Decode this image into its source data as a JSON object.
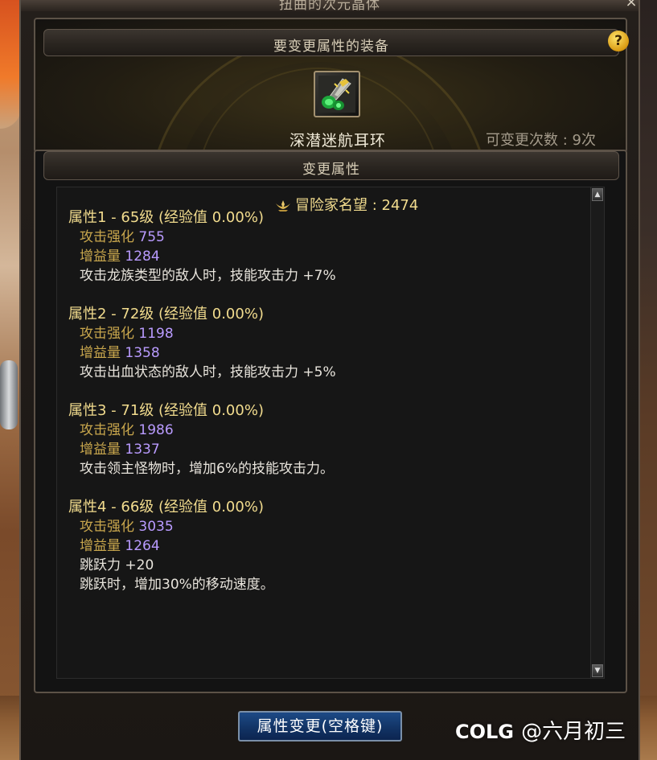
{
  "window": {
    "title": "扭曲的次元晶体",
    "close_label": "×"
  },
  "equipment": {
    "header": "要变更属性的装备",
    "help_label": "?",
    "item_name": "深潜迷航耳环",
    "change_count": "可变更次数 : 9次",
    "item_icon": "earring-icon"
  },
  "attributes": {
    "header": "变更属性",
    "renown_label": "冒险家名望 : 2474",
    "groups": [
      {
        "title": "属性1 - 65级 (经验值 0.00%)",
        "lines": [
          {
            "label": "攻击强化",
            "value": "755"
          },
          {
            "label": "增益量",
            "value": "1284"
          }
        ],
        "effects": [
          "攻击龙族类型的敌人时，技能攻击力 +7%"
        ]
      },
      {
        "title": "属性2 - 72级 (经验值 0.00%)",
        "lines": [
          {
            "label": "攻击强化",
            "value": "1198"
          },
          {
            "label": "增益量",
            "value": "1358"
          }
        ],
        "effects": [
          "攻击出血状态的敌人时，技能攻击力 +5%"
        ]
      },
      {
        "title": "属性3 - 71级 (经验值 0.00%)",
        "lines": [
          {
            "label": "攻击强化",
            "value": "1986"
          },
          {
            "label": "增益量",
            "value": "1337"
          }
        ],
        "effects": [
          "攻击领主怪物时，增加6%的技能攻击力。"
        ]
      },
      {
        "title": "属性4 - 66级 (经验值 0.00%)",
        "lines": [
          {
            "label": "攻击强化",
            "value": "3035"
          },
          {
            "label": "增益量",
            "value": "1264"
          }
        ],
        "effects": [
          "跳跃力 +20",
          "跳跃时，增加30%的移动速度。"
        ]
      }
    ]
  },
  "scrollbar": {
    "up_label": "▲",
    "down_label": "▼"
  },
  "action": {
    "change_button": "属性变更(空格键)"
  },
  "watermark": {
    "brand": "COLG",
    "user": "@六月初三"
  },
  "colors": {
    "gold_text": "#f2dc8e",
    "label_gold": "#c9a74d",
    "value_purple": "#b99bff",
    "button_blue": "#123466"
  }
}
